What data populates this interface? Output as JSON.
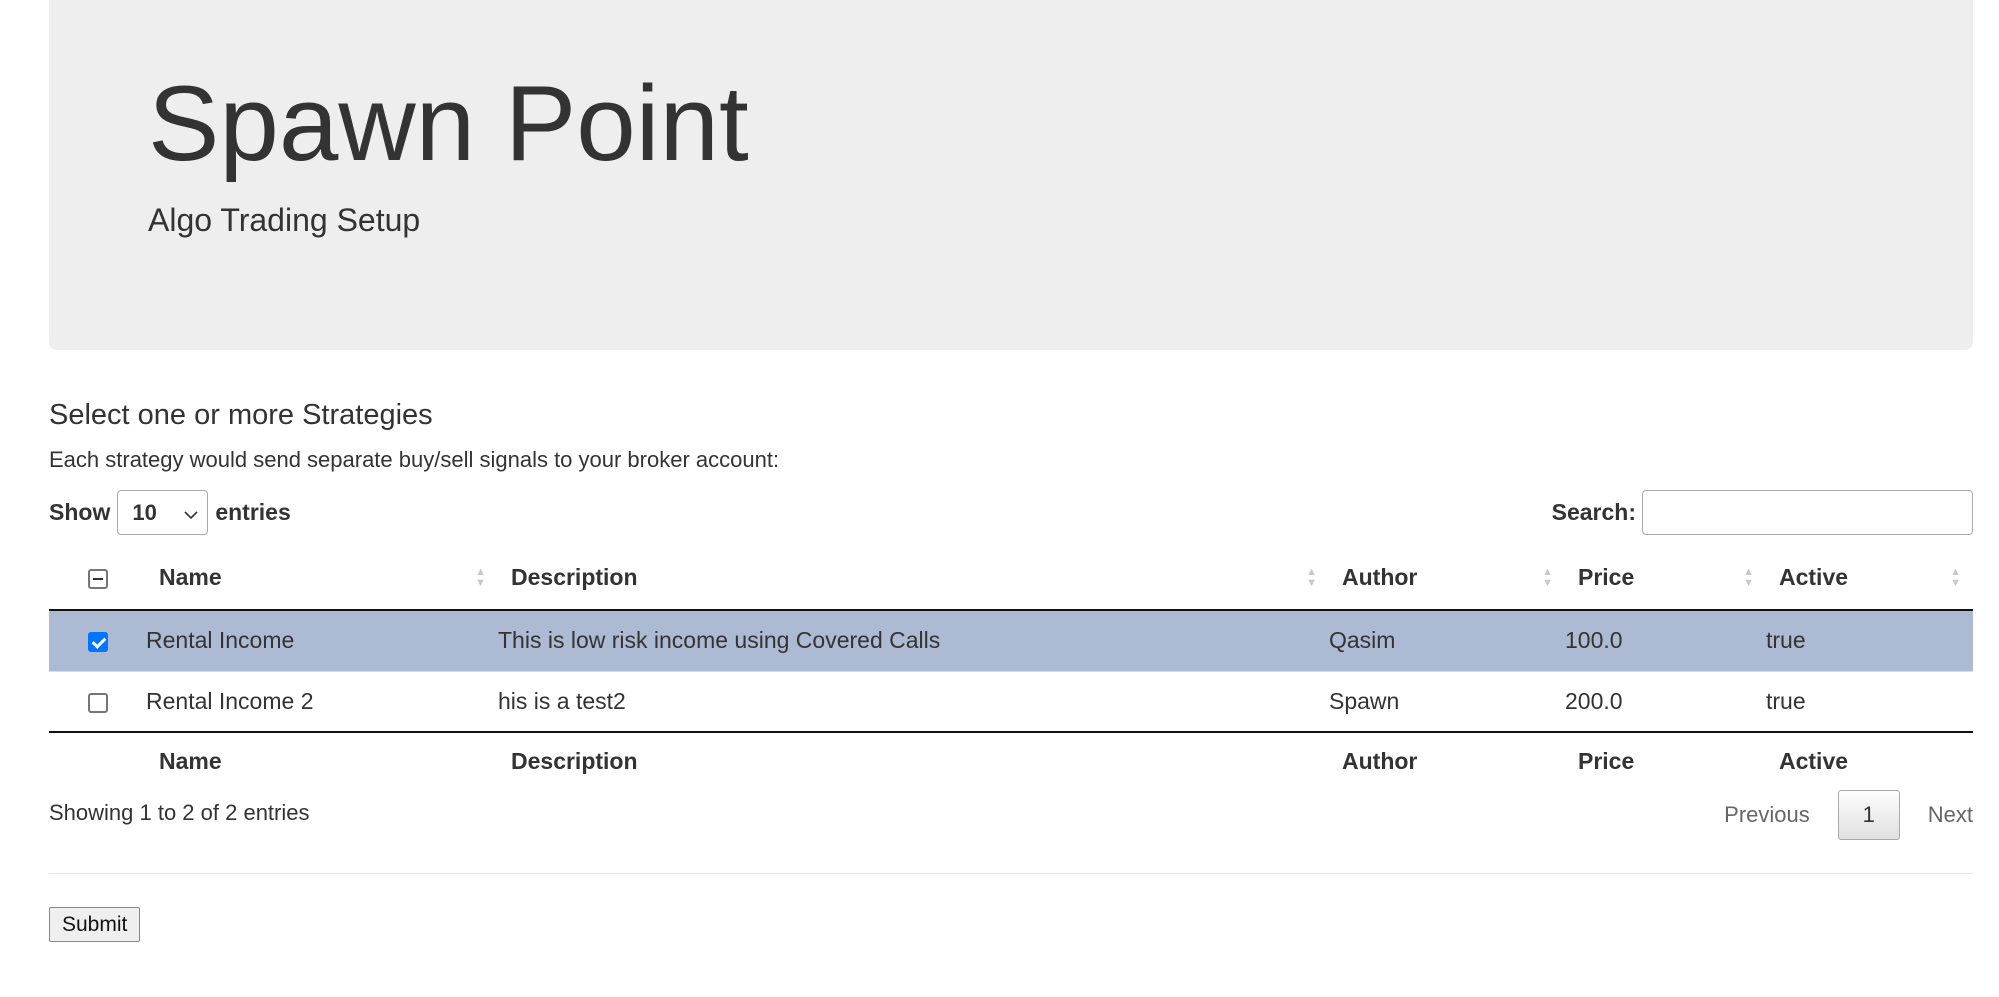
{
  "header": {
    "title": "Spawn Point",
    "subtitle": "Algo Trading Setup"
  },
  "section": {
    "title": "Select one or more Strategies",
    "description": "Each strategy would send separate buy/sell signals to your broker account:"
  },
  "length_control": {
    "show_label": "Show",
    "selected": "10",
    "entries_label": "entries"
  },
  "search": {
    "label": "Search:",
    "value": "",
    "placeholder": ""
  },
  "table": {
    "columns": [
      "Name",
      "Description",
      "Author",
      "Price",
      "Active"
    ],
    "rows": [
      {
        "selected": true,
        "name": "Rental Income",
        "description": "This is low risk income using Covered Calls",
        "author": "Qasim",
        "price": "100.0",
        "active": "true"
      },
      {
        "selected": false,
        "name": "Rental Income 2",
        "description": "his is a test2",
        "author": "Spawn",
        "price": "200.0",
        "active": "true"
      }
    ]
  },
  "footer": {
    "info": "Showing 1 to 2 of 2 entries",
    "previous": "Previous",
    "page": "1",
    "next": "Next"
  },
  "submit_label": "Submit",
  "colors": {
    "selected_row": "#acbad4",
    "jumbotron_bg": "#eeeeee",
    "checkbox_accent": "#0075ff"
  }
}
